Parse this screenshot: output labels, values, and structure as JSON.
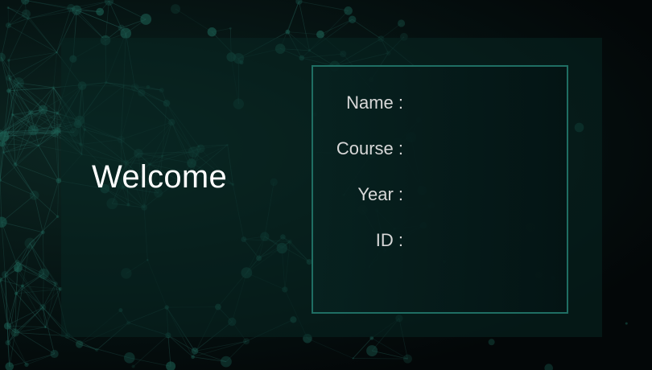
{
  "welcome": {
    "title": "Welcome"
  },
  "form": {
    "fields": [
      {
        "label": "Name :"
      },
      {
        "label": "Course :"
      },
      {
        "label": "Year :"
      },
      {
        "label": "ID :"
      }
    ]
  },
  "colors": {
    "background": "#030708",
    "panel": "#0a2622",
    "box_border": "#1f6e63",
    "label_text": "#d8d8d8",
    "title_text": "#ffffff",
    "network_node": "#1b5e52"
  }
}
